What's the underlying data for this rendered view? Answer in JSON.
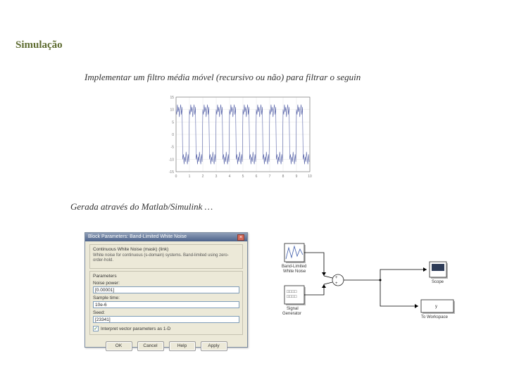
{
  "heading": "Simulação",
  "line1": "Implementar um filtro média móvel (recursivo ou não) para filtrar o seguin",
  "line2": "Gerada através do Matlab/Simulink …",
  "chart_data": {
    "type": "line",
    "title": "",
    "xlabel": "",
    "ylabel": "",
    "xlim": [
      0,
      10
    ],
    "ylim": [
      -15,
      15
    ],
    "x": [
      0,
      0.05,
      0.1,
      0.15,
      0.2,
      0.25,
      0.3,
      0.35,
      0.4,
      0.45,
      0.5,
      0.55,
      0.6,
      0.65,
      0.7,
      0.75,
      0.8,
      0.85,
      0.9,
      0.95,
      1,
      1.05,
      1.1,
      1.15,
      1.2,
      1.25,
      1.3,
      1.35,
      1.4,
      1.45,
      1.5,
      1.55,
      1.6,
      1.65,
      1.7,
      1.75,
      1.8,
      1.85,
      1.9,
      1.95,
      2,
      2.05,
      2.1,
      2.15,
      2.2,
      2.25,
      2.3,
      2.35,
      2.4,
      2.45,
      2.5,
      2.55,
      2.6,
      2.65,
      2.7,
      2.75,
      2.8,
      2.85,
      2.9,
      2.95,
      3,
      3.05,
      3.1,
      3.15,
      3.2,
      3.25,
      3.3,
      3.35,
      3.4,
      3.45,
      3.5,
      3.55,
      3.6,
      3.65,
      3.7,
      3.75,
      3.8,
      3.85,
      3.9,
      3.95,
      4,
      4.05,
      4.1,
      4.15,
      4.2,
      4.25,
      4.3,
      4.35,
      4.4,
      4.45,
      4.5,
      4.55,
      4.6,
      4.65,
      4.7,
      4.75,
      4.8,
      4.85,
      4.9,
      4.95,
      5,
      5.05,
      5.1,
      5.15,
      5.2,
      5.25,
      5.3,
      5.35,
      5.4,
      5.45,
      5.5,
      5.55,
      5.6,
      5.65,
      5.7,
      5.75,
      5.8,
      5.85,
      5.9,
      5.95,
      6,
      6.05,
      6.1,
      6.15,
      6.2,
      6.25,
      6.3,
      6.35,
      6.4,
      6.45,
      6.5,
      6.55,
      6.6,
      6.65,
      6.7,
      6.75,
      6.8,
      6.85,
      6.9,
      6.95,
      7,
      7.05,
      7.1,
      7.15,
      7.2,
      7.25,
      7.3,
      7.35,
      7.4,
      7.45,
      7.5,
      7.55,
      7.6,
      7.65,
      7.7,
      7.75,
      7.8,
      7.85,
      7.9,
      7.95,
      8,
      8.05,
      8.1,
      8.15,
      8.2,
      8.25,
      8.3,
      8.35,
      8.4,
      8.45,
      8.5,
      8.55,
      8.6,
      8.65,
      8.7,
      8.75,
      8.8,
      8.85,
      8.9,
      8.95,
      9,
      9.05,
      9.1,
      9.15,
      9.2,
      9.25,
      9.3,
      9.35,
      9.4,
      9.45,
      9.5,
      9.55,
      9.6,
      9.65,
      9.7,
      9.75,
      9.8,
      9.85,
      9.9,
      9.95
    ],
    "values": [
      10,
      8,
      12,
      9,
      11,
      7,
      10,
      12,
      8,
      11,
      -10,
      -8,
      -12,
      -9,
      -11,
      -7,
      -10,
      -12,
      -8,
      -11,
      10,
      8,
      12,
      9,
      11,
      7,
      10,
      12,
      8,
      11,
      -10,
      -8,
      -12,
      -9,
      -11,
      -7,
      -10,
      -12,
      -8,
      -11,
      10,
      8,
      12,
      9,
      11,
      7,
      10,
      12,
      8,
      11,
      -10,
      -8,
      -12,
      -9,
      -11,
      -7,
      -10,
      -12,
      -8,
      -11,
      10,
      8,
      12,
      9,
      11,
      7,
      10,
      12,
      8,
      11,
      -10,
      -8,
      -12,
      -9,
      -11,
      -7,
      -10,
      -12,
      -8,
      -11,
      10,
      8,
      12,
      9,
      11,
      7,
      10,
      12,
      8,
      11,
      -10,
      -8,
      -12,
      -9,
      -11,
      -7,
      -10,
      -12,
      -8,
      -11,
      10,
      8,
      12,
      9,
      11,
      7,
      10,
      12,
      8,
      11,
      -10,
      -8,
      -12,
      -9,
      -11,
      -7,
      -10,
      -12,
      -8,
      -11,
      10,
      8,
      12,
      9,
      11,
      7,
      10,
      12,
      8,
      11,
      -10,
      -8,
      -12,
      -9,
      -11,
      -7,
      -10,
      -12,
      -8,
      -11,
      10,
      8,
      12,
      9,
      11,
      7,
      10,
      12,
      8,
      11,
      -10,
      -8,
      -12,
      -9,
      -11,
      -7,
      -10,
      -12,
      -8,
      -11,
      10,
      8,
      12,
      9,
      11,
      7,
      10,
      12,
      8,
      11,
      -10,
      -8,
      -12,
      -9,
      -11,
      -7,
      -10,
      -12,
      -8,
      -11,
      10,
      8,
      12,
      9,
      11,
      7,
      10,
      12,
      8,
      11,
      -10,
      -8,
      -12,
      -9,
      -11,
      -7,
      -10,
      -12,
      -8,
      -11
    ]
  },
  "dialog": {
    "title": "Block Parameters: Band-Limited White Noise",
    "close": "×",
    "group1_title": "Continuous White Noise (mask) (link)",
    "desc": "White noise for continuous (s-domain) systems. Band-limited using zero-order-hold.",
    "group2_title": "Parameters",
    "p1_label": "Noise power:",
    "p1_value": "[0.00001]",
    "p2_label": "Sample time:",
    "p2_value": "10e-6",
    "p3_label": "Seed:",
    "p3_value": "[23341]",
    "check_label": "Interpret vector parameters as 1-D",
    "check_mark": "✓",
    "btn_ok": "OK",
    "btn_cancel": "Cancel",
    "btn_help": "Help",
    "btn_apply": "Apply"
  },
  "schematic": {
    "block_noise": "Band-Limited\nWhite Noise",
    "block_signal": "Signal\nGenerator",
    "block_scope": "Scope",
    "block_ws": "To Workspace",
    "signal_icon_text": "□□□□\n□□□□"
  }
}
